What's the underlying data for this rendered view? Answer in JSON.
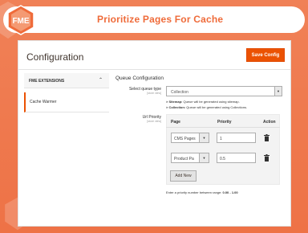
{
  "header": {
    "title": "Prioritize Pages For Cache",
    "logo_text": "FME"
  },
  "config": {
    "title": "Configuration",
    "save_label": "Save Config"
  },
  "sidebar": {
    "section_label": "FME EXTENSIONS",
    "items": [
      {
        "label": "Cache Warmer"
      }
    ]
  },
  "main": {
    "section_title": "Queue Configuration",
    "queue_type": {
      "label": "Select queue type",
      "scope": "[store view]",
      "value": "Collection",
      "notes": [
        {
          "key": "> Sitemap:",
          "text": "Queue will be generated using sitemap."
        },
        {
          "key": "> Collection:",
          "text": "Queue will be generated using Collections."
        }
      ]
    },
    "url_priority": {
      "label": "Url Priority",
      "scope": "[store view]",
      "columns": [
        "Page",
        "Priority",
        "Action"
      ],
      "rows": [
        {
          "page": "CMS Pages",
          "priority": "1"
        },
        {
          "page": "Product Pa",
          "priority": "0.5"
        }
      ],
      "add_label": "Add New",
      "hint_prefix": "Enter a priority number between range:",
      "hint_range": "0.00 - 1.00"
    }
  },
  "colors": {
    "brand": "#ef6b3a",
    "save": "#eb5202",
    "background": "#ef7a4d"
  }
}
